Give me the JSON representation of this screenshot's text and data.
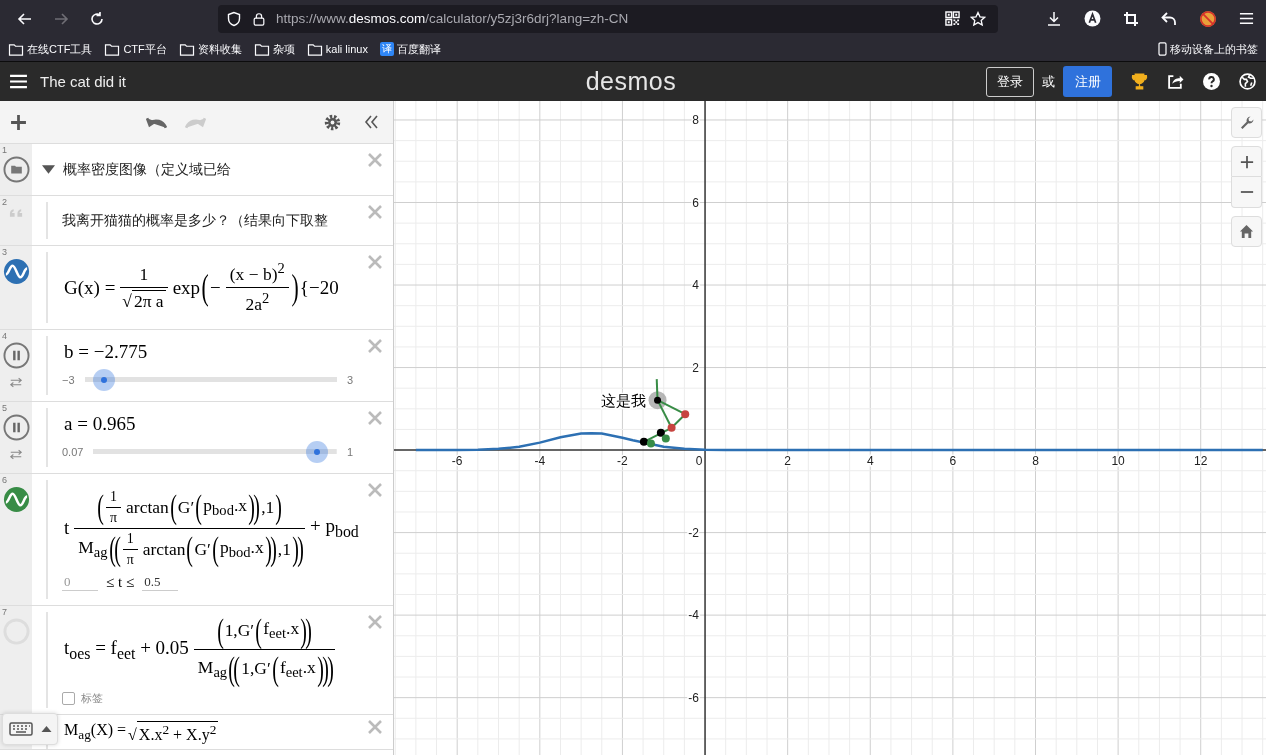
{
  "browser": {
    "nav": {
      "back_disabled": false,
      "forward_disabled": true
    },
    "url": {
      "scheme": "https://www.",
      "domain": "desmos.com",
      "path": "/calculator/y5zj3r6drj?lang=zh-CN"
    },
    "bookmarks": [
      {
        "kind": "folder",
        "label": "在线CTF工具"
      },
      {
        "kind": "folder",
        "label": "CTF平台"
      },
      {
        "kind": "folder",
        "label": "资料收集"
      },
      {
        "kind": "folder",
        "label": "杂项"
      },
      {
        "kind": "folder",
        "label": "kali linux"
      },
      {
        "kind": "translate",
        "icon": "译",
        "label": "百度翻译"
      }
    ],
    "mobile_bookmarks": "移动设备上的书签"
  },
  "header": {
    "title": "The cat did it",
    "logo": "desmos",
    "login": "登录",
    "or": "或",
    "signup": "注册"
  },
  "list_toolbar": {
    "undo_disabled": false,
    "redo_disabled": true
  },
  "expressions": [
    {
      "number": "1",
      "kind": "folder",
      "expanded": true,
      "text": "概率密度图像（定义域已给"
    },
    {
      "number": "2",
      "kind": "note",
      "text": "我离开猫猫的概率是多少？（结果向下取整"
    },
    {
      "number": "3",
      "kind": "expression",
      "shown": true,
      "color": "#2d70b3",
      "math": [
        {
          "kind": "t",
          "s": "G(x) ="
        },
        {
          "kind": "frac",
          "num": [
            {
              "kind": "t",
              "s": "1"
            }
          ],
          "den": [
            {
              "kind": "sqrt",
              "sign": "√",
              "s": "2π a"
            }
          ]
        },
        {
          "kind": "t",
          "s": "exp"
        },
        {
          "kind": "big",
          "s": "("
        },
        {
          "kind": "t",
          "s": "−"
        },
        {
          "kind": "frac",
          "num": [
            {
              "kind": "t",
              "s": "(x − b)$^{2}$"
            }
          ],
          "den": [
            {
              "kind": "t",
              "s": "2a$^{2}$"
            }
          ]
        },
        {
          "kind": "big",
          "s": ")"
        },
        {
          "kind": "t",
          "s": "{−20"
        }
      ]
    },
    {
      "number": "4",
      "kind": "slider",
      "math": [
        {
          "kind": "t",
          "s": "b = −2.775"
        }
      ],
      "min": "−3",
      "max": "3",
      "level": 0.0375
    },
    {
      "number": "5",
      "kind": "slider",
      "math": [
        {
          "kind": "t",
          "s": "a = 0.965"
        }
      ],
      "min": "0.07",
      "max": "1",
      "level": 0.962
    },
    {
      "number": "6",
      "kind": "expression",
      "shown": true,
      "color": "#388c46",
      "math": [
        {
          "kind": "t",
          "s": "t"
        },
        {
          "kind": "frac",
          "num": [
            {
              "kind": "big",
              "s": "("
            },
            {
              "kind": "frac",
              "num": [
                {
                  "kind": "t",
                  "s": "1"
                }
              ],
              "den": [
                {
                  "kind": "t",
                  "s": "π"
                }
              ]
            },
            {
              "kind": "t",
              "s": "arctan"
            },
            {
              "kind": "big",
              "s": "("
            },
            {
              "kind": "t",
              "s": "G′"
            },
            {
              "kind": "big",
              "s": "("
            },
            {
              "kind": "t",
              "s": "p$_{bod}$.x"
            },
            {
              "kind": "big",
              "s": ")"
            },
            {
              "kind": "big",
              "s": ")"
            },
            {
              "kind": "t",
              "s": ",1"
            },
            {
              "kind": "big",
              "s": ")"
            }
          ],
          "den": [
            {
              "kind": "t",
              "s": "M$_{ag}$"
            },
            {
              "kind": "big",
              "s": "("
            },
            {
              "kind": "big",
              "s": "("
            },
            {
              "kind": "frac",
              "num": [
                {
                  "kind": "t",
                  "s": "1"
                }
              ],
              "den": [
                {
                  "kind": "t",
                  "s": "π"
                }
              ]
            },
            {
              "kind": "t",
              "s": "arctan"
            },
            {
              "kind": "big",
              "s": "("
            },
            {
              "kind": "t",
              "s": "G′"
            },
            {
              "kind": "big",
              "s": "("
            },
            {
              "kind": "t",
              "s": "p$_{bod}$.x"
            },
            {
              "kind": "big",
              "s": ")"
            },
            {
              "kind": "big",
              "s": ")"
            },
            {
              "kind": "t",
              "s": ",1"
            },
            {
              "kind": "big",
              "s": ")"
            },
            {
              "kind": "big",
              "s": ")"
            }
          ]
        },
        {
          "kind": "t",
          "s": "+ p$_{bod}$"
        }
      ],
      "domain": {
        "min": "0",
        "middle": "≤ t ≤",
        "max": "0.5"
      }
    },
    {
      "number": "7",
      "kind": "expression",
      "shown": false,
      "math": [
        {
          "kind": "t",
          "s": "t$_{oes}$ = f$_{eet}$ + 0.05"
        },
        {
          "kind": "frac",
          "num": [
            {
              "kind": "big",
              "s": "("
            },
            {
              "kind": "t",
              "s": "1,G′"
            },
            {
              "kind": "big",
              "s": "("
            },
            {
              "kind": "t",
              "s": "f$_{eet}$.x"
            },
            {
              "kind": "big",
              "s": ")"
            },
            {
              "kind": "big",
              "s": ")"
            }
          ],
          "den": [
            {
              "kind": "t",
              "s": "M$_{ag}$"
            },
            {
              "kind": "big",
              "s": "("
            },
            {
              "kind": "big",
              "s": "("
            },
            {
              "kind": "t",
              "s": "1,G′"
            },
            {
              "kind": "big",
              "s": "("
            },
            {
              "kind": "t",
              "s": "f$_{eet}$.x"
            },
            {
              "kind": "big",
              "s": ")"
            },
            {
              "kind": "big",
              "s": ")"
            },
            {
              "kind": "big",
              "s": ")"
            }
          ]
        }
      ],
      "label_checkbox": {
        "label": "标签",
        "checked": false
      }
    },
    {
      "kind": "expression",
      "math": [
        {
          "kind": "t",
          "s": "M$_{ag}$(X) ="
        },
        {
          "kind": "sqrt",
          "sign": "√",
          "s": "X.x$^{2}$ + X.y$^{2}$"
        }
      ]
    }
  ],
  "graph": {
    "point_label": "这是我",
    "chart_data": {
      "type": "line",
      "grid": true,
      "x": [
        -7,
        -6,
        -5.5,
        -5,
        -4.5,
        -4,
        -3.5,
        -3,
        -2.75,
        -2.5,
        -2,
        -1.75,
        -1,
        -0.5,
        0,
        0.5,
        1,
        2,
        13.5
      ],
      "series": [
        {
          "color": "#2d70b3",
          "values": [
            0,
            0,
            0.01,
            0.03,
            0.08,
            0.18,
            0.31,
            0.4,
            0.41,
            0.4,
            0.3,
            0.24,
            0.08,
            0.03,
            0.01,
            0,
            0,
            0,
            0
          ]
        }
      ],
      "xlim": [
        -7.53,
        13.58
      ],
      "ylim": [
        -7.39,
        8.46
      ],
      "xticks": [
        -6,
        -4,
        -2,
        0,
        2,
        4,
        6,
        8,
        10,
        12
      ],
      "yticks": [
        -6,
        -4,
        -2,
        2,
        4,
        6,
        8
      ]
    }
  }
}
